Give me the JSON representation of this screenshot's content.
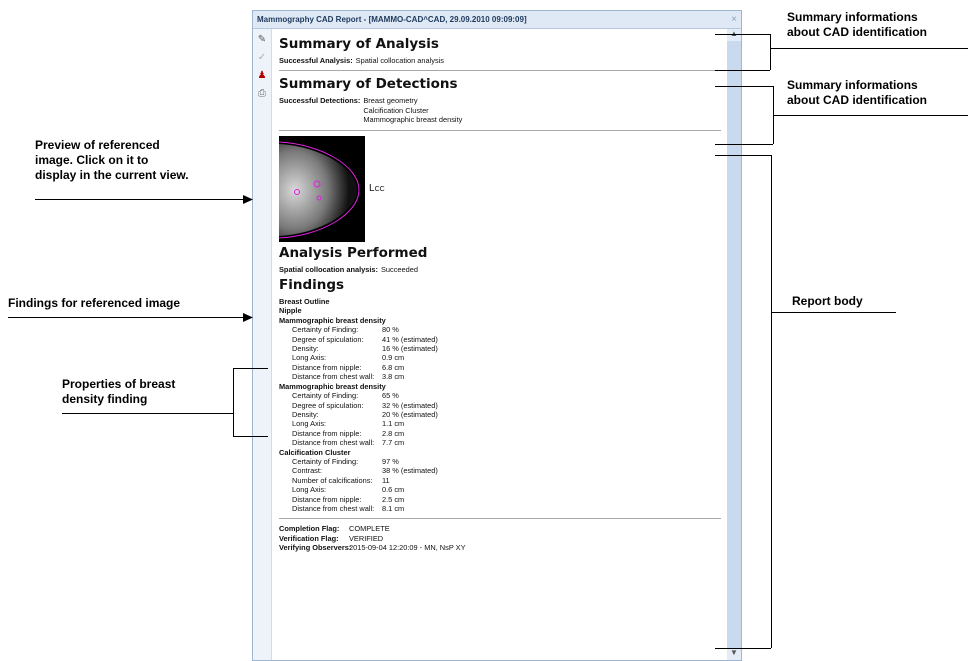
{
  "window": {
    "title": "Mammography CAD Report - [MAMMO-CAD^CAD, 29.09.2010 09:09:09]",
    "close_glyph": "×"
  },
  "toolbar": {
    "icons": [
      "pencil-icon",
      "check-icon",
      "stamp-icon",
      "print-icon"
    ]
  },
  "summary_analysis": {
    "heading": "Summary of Analysis",
    "label": "Successful Analysis:",
    "value": "Spatial collocation analysis"
  },
  "summary_detections": {
    "heading": "Summary of Detections",
    "label": "Successful Detections:",
    "values": [
      "Breast geometry",
      "Calcification Cluster",
      "Mammographic breast density"
    ]
  },
  "preview": {
    "view_label_main": "L",
    "view_label_sub": "CC"
  },
  "analysis_performed": {
    "heading": "Analysis Performed",
    "label": "Spatial collocation analysis:",
    "value": "Succeeded"
  },
  "findings": {
    "heading": "Findings",
    "simple": [
      "Breast Outline",
      "Nipple"
    ],
    "groups": [
      {
        "title": "Mammographic breast density",
        "props": [
          {
            "k": "Certainty of Finding:",
            "v": "80 %"
          },
          {
            "k": "Degree of spiculation:",
            "v": "41 % (estimated)"
          },
          {
            "k": "Density:",
            "v": "16 % (estimated)"
          },
          {
            "k": "Long Axis:",
            "v": "0.9 cm"
          },
          {
            "k": "Distance from nipple:",
            "v": "6.8 cm"
          },
          {
            "k": "Distance from chest wall:",
            "v": "3.8 cm"
          }
        ]
      },
      {
        "title": "Mammographic breast density",
        "props": [
          {
            "k": "Certainty of Finding:",
            "v": "65 %"
          },
          {
            "k": "Degree of spiculation:",
            "v": "32 % (estimated)"
          },
          {
            "k": "Density:",
            "v": "20 % (estimated)"
          },
          {
            "k": "Long Axis:",
            "v": "1.1 cm"
          },
          {
            "k": "Distance from nipple:",
            "v": "2.8 cm"
          },
          {
            "k": "Distance from chest wall:",
            "v": "7.7 cm"
          }
        ]
      },
      {
        "title": "Calcification Cluster",
        "props": [
          {
            "k": "Certainty of Finding:",
            "v": "97 %"
          },
          {
            "k": "Contrast:",
            "v": "38 % (estimated)"
          },
          {
            "k": "Number of calcifications:",
            "v": "11"
          },
          {
            "k": "Long Axis:",
            "v": "0.6 cm"
          },
          {
            "k": "Distance from nipple:",
            "v": "2.5 cm"
          },
          {
            "k": "Distance from chest wall:",
            "v": "8.1 cm"
          }
        ]
      }
    ]
  },
  "footer": {
    "rows": [
      {
        "k": "Completion Flag:",
        "v": "COMPLETE"
      },
      {
        "k": "Verification Flag:",
        "v": "VERIFIED"
      },
      {
        "k": "Verifying Observers:",
        "v": "2015-09-04 12:20:09 - MN, NsP XY"
      }
    ]
  },
  "callouts": {
    "summary_1": [
      "Summary informations",
      "about CAD identification"
    ],
    "summary_2": [
      "Summary informations",
      "about CAD identification"
    ],
    "preview": [
      "Preview of referenced",
      "image. Click on it to",
      "display in the current view."
    ],
    "findings": [
      "Findings for referenced image"
    ],
    "properties": [
      "Properties of breast",
      "density finding"
    ],
    "report_body": [
      "Report body"
    ]
  }
}
